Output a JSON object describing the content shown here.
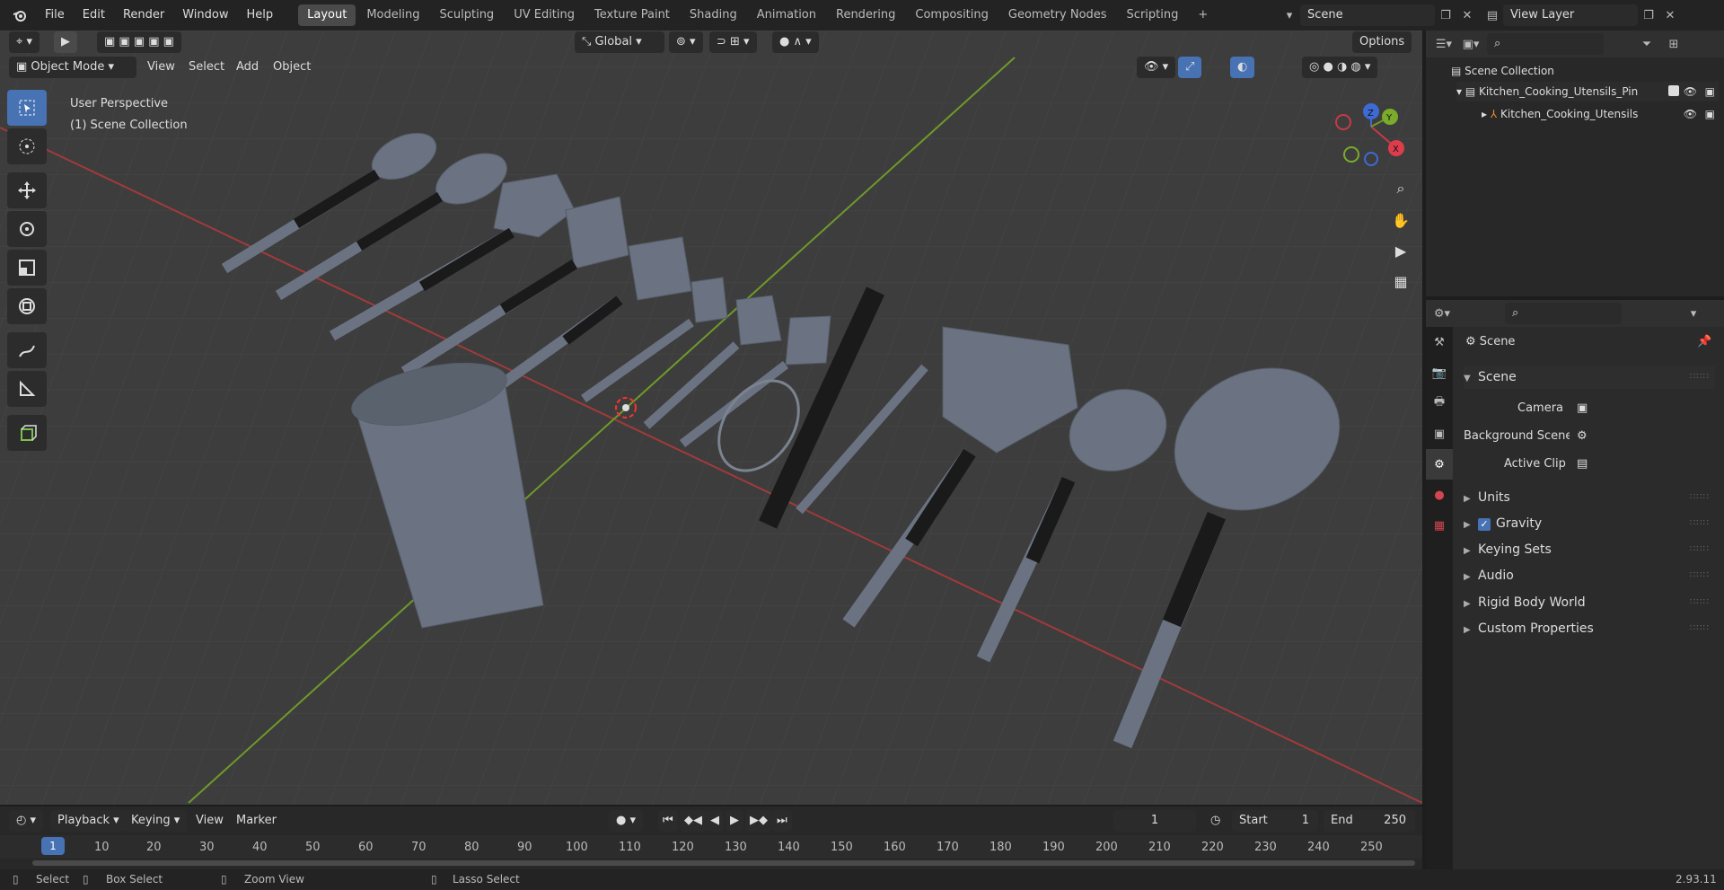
{
  "menu": [
    "File",
    "Edit",
    "Render",
    "Window",
    "Help"
  ],
  "workspaces": [
    "Layout",
    "Modeling",
    "Sculpting",
    "UV Editing",
    "Texture Paint",
    "Shading",
    "Animation",
    "Rendering",
    "Compositing",
    "Geometry Nodes",
    "Scripting"
  ],
  "active_workspace": "Layout",
  "scene_field": "Scene",
  "view_layer_field": "View Layer",
  "viewport": {
    "mode": "Object Mode",
    "menus": [
      "View",
      "Select",
      "Add",
      "Object"
    ],
    "transform": "Global",
    "options": "Options",
    "perspective": "User Perspective",
    "collection": "(1) Scene Collection",
    "gizmo": {
      "x": "X",
      "y": "Y",
      "z": "Z"
    }
  },
  "outliner": {
    "root": "Scene Collection",
    "items": [
      {
        "label": "Kitchen_Cooking_Utensils_Pin",
        "level": 1
      },
      {
        "label": "Kitchen_Cooking_Utensils",
        "level": 2
      }
    ]
  },
  "properties": {
    "header": "Scene",
    "section": "Scene",
    "camera_label": "Camera",
    "bg_scene_label": "Background Scene",
    "active_clip_label": "Active Clip",
    "panels": [
      "Units",
      "Gravity",
      "Keying Sets",
      "Audio",
      "Rigid Body World",
      "Custom Properties"
    ],
    "gravity_checked": true
  },
  "timeline": {
    "menus": [
      "Playback",
      "Keying",
      "View",
      "Marker"
    ],
    "current_frame": "1",
    "start_label": "Start",
    "start": "1",
    "end_label": "End",
    "end": "250",
    "ticks": [
      "1",
      "10",
      "20",
      "30",
      "40",
      "50",
      "60",
      "70",
      "80",
      "90",
      "100",
      "110",
      "120",
      "130",
      "140",
      "150",
      "160",
      "170",
      "180",
      "190",
      "200",
      "210",
      "220",
      "230",
      "240",
      "250"
    ]
  },
  "status": {
    "select": "Select",
    "box_select": "Box Select",
    "zoom": "Zoom View",
    "lasso": "Lasso Select",
    "version": "2.93.11"
  },
  "colors": {
    "accent": "#4772b3",
    "x_axis": "#b33a3a",
    "y_axis": "#6f9a2a",
    "bg": "#3d3d3d"
  }
}
